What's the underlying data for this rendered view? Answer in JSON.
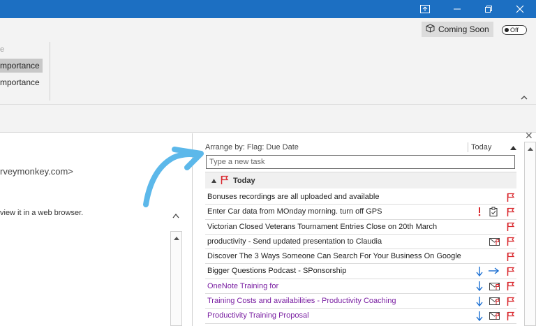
{
  "ribbon": {
    "faint_label": "e",
    "item_1": "mportance",
    "item_2": "mportance",
    "coming_soon": "Coming Soon",
    "toggle_label": "Off"
  },
  "reading_pane": {
    "sender_address": "rveymonkey.com>",
    "browser_note": "view it in a web browser."
  },
  "tasks": {
    "arrange_by": "Arrange by: Flag: Due Date",
    "column_today": "Today",
    "new_task_placeholder": "Type a new task",
    "group_label": "Today",
    "items": [
      {
        "title": "Bonuses recordings are all uploaded and available",
        "color": "normal"
      },
      {
        "title": "Enter Car data from MOnday morning. turn off GPS",
        "color": "normal"
      },
      {
        "title": "Victorian Closed Veterans Tournament Entries Close on 20th March",
        "color": "normal"
      },
      {
        "title": "productivity - Send updated presentation to Claudia",
        "color": "normal"
      },
      {
        "title": "Discover The 3 Ways Someone Can Search For Your Business On Google",
        "color": "normal"
      },
      {
        "title": "Bigger Questions Podcast - SPonsorship",
        "color": "normal"
      },
      {
        "title": "OneNote Training for",
        "color": "purple"
      },
      {
        "title": "Training Costs and availabilities - Productivity Coaching",
        "color": "purple"
      },
      {
        "title": "Productivity Training Proposal",
        "color": "purple"
      }
    ]
  },
  "colors": {
    "titlebar": "#1c6fc2",
    "flag_red": "#d9262c",
    "arrow_blue": "#1b6fd1",
    "annotation_arrow": "#5cb8ea",
    "purple_text": "#7a1fa2"
  }
}
